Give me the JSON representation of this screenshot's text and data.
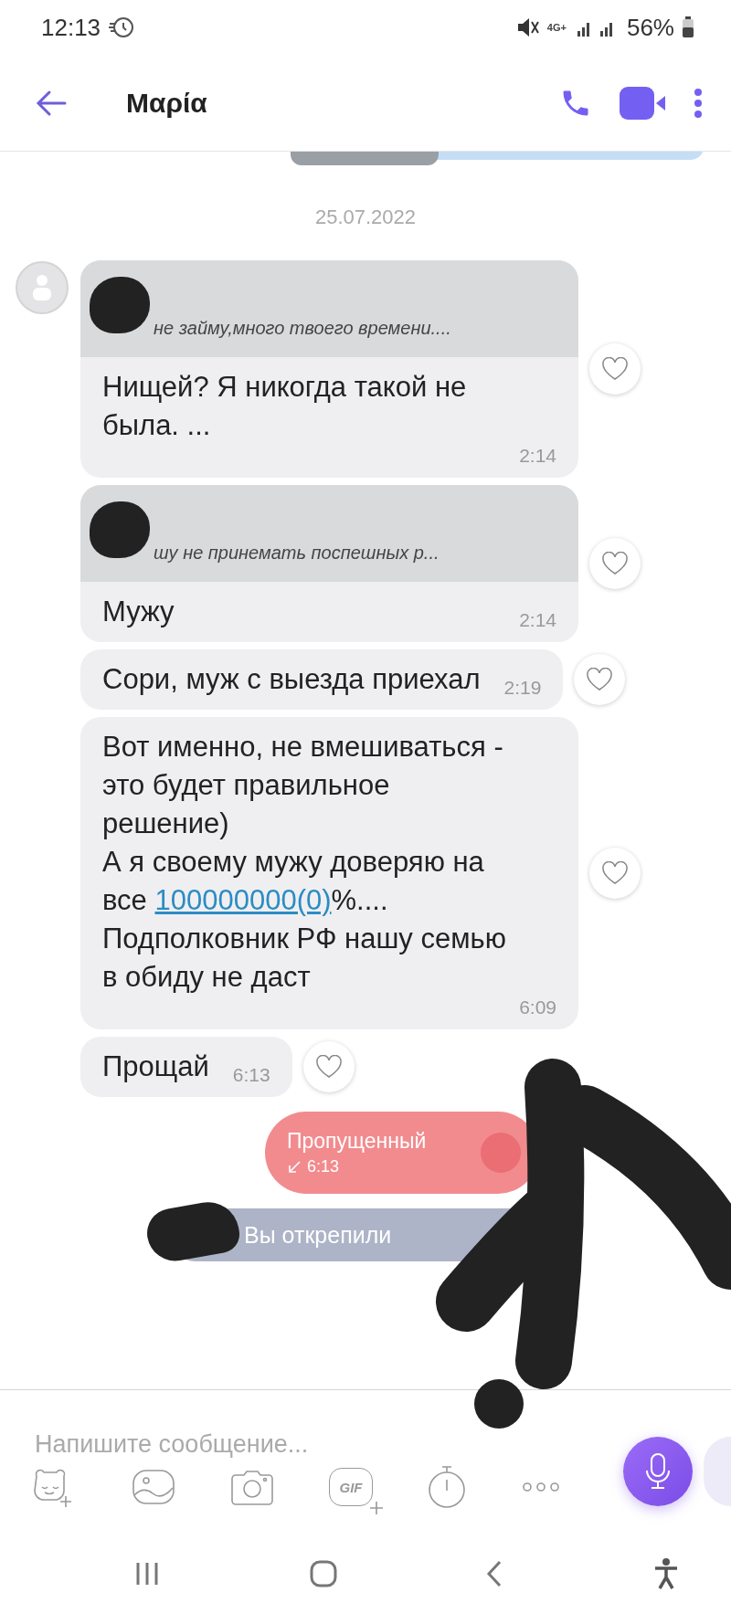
{
  "status_bar": {
    "time": "12:13",
    "network": "4G+",
    "battery": "56%"
  },
  "header": {
    "title": "Μαρία"
  },
  "messages": [
    {
      "kind": "date",
      "text": "25.07.2022"
    },
    {
      "kind": "incoming",
      "show_avatar": true,
      "quote": "не займу,много твоего времени....",
      "parts": [
        {
          "text": "Нищей? Я никогда такой не была. ...",
          "link": false
        }
      ],
      "time": "2:14"
    },
    {
      "kind": "incoming",
      "show_avatar": false,
      "quote": "шу не принемать поспешных р...",
      "parts": [
        {
          "text": "Мужу",
          "link": false
        }
      ],
      "time": "2:14"
    },
    {
      "kind": "incoming",
      "show_avatar": false,
      "parts": [
        {
          "text": "Сори, муж с выезда приехал",
          "link": false
        }
      ],
      "time": "2:19"
    },
    {
      "kind": "incoming",
      "show_avatar": false,
      "parts": [
        {
          "text": "Вот именно, не вмешиваться - это будет правильное решение)\nА я своему мужу доверяю на все ",
          "link": false
        },
        {
          "text": "100000000(0)",
          "link": true
        },
        {
          "text": "%....\nПодполковник РФ нашу семью в обиду не даст",
          "link": false
        }
      ],
      "time": "6:09"
    },
    {
      "kind": "incoming",
      "show_avatar": false,
      "parts": [
        {
          "text": "Прощай",
          "link": false
        }
      ],
      "time": "6:13"
    },
    {
      "kind": "missed_call",
      "text": "Пропущенный",
      "time": "6:13"
    },
    {
      "kind": "notice",
      "text": "Вы открепили"
    }
  ],
  "composer": {
    "placeholder": "Напишите сообщение...",
    "gif_label": "GIF"
  }
}
